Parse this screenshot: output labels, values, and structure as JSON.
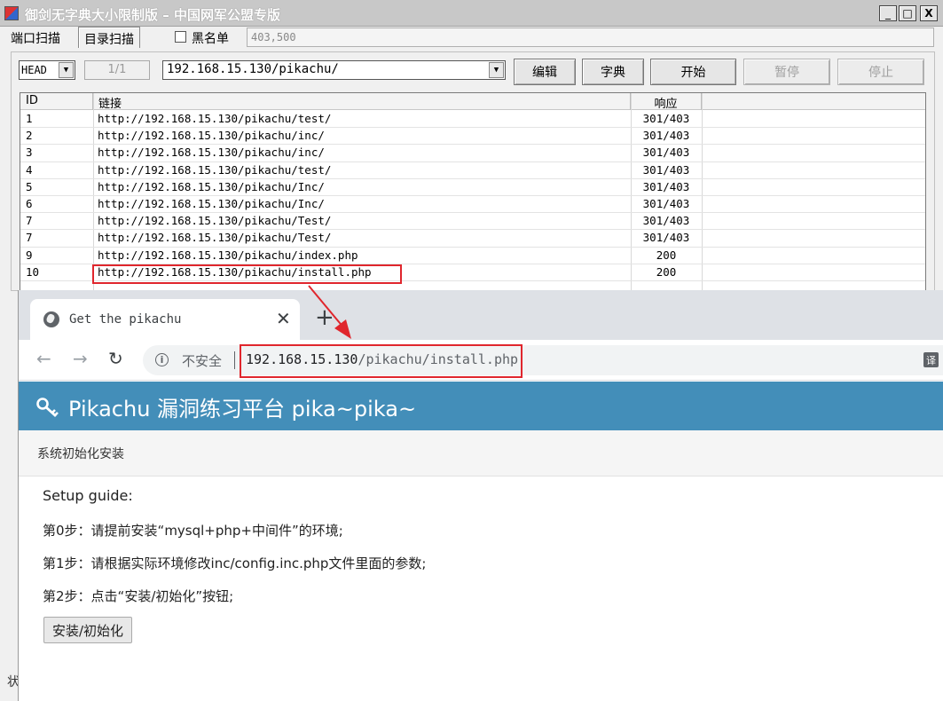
{
  "scanner": {
    "title": "御剑无字典大小限制版 – 中国网军公盟专版",
    "window_controls": {
      "minimize": "_",
      "maximize": "□",
      "close": "X"
    },
    "tabs": [
      {
        "label": "端口扫描"
      },
      {
        "label": "目录扫描"
      }
    ],
    "blacklist_label": "黑名单",
    "blacklist_checked": false,
    "status_codes_value": "403,500",
    "method": "HEAD",
    "page_counter": "1/1",
    "target_url": "192.168.15.130/pikachu/",
    "buttons": {
      "edit": "编辑",
      "dictionary": "字典",
      "start": "开始",
      "pause": "暂停",
      "stop": "停止"
    },
    "columns": {
      "id": "ID",
      "link": "链接",
      "response": "响应"
    },
    "rows": [
      {
        "id": "1",
        "link": "http://192.168.15.130/pikachu/test/",
        "response": "301/403"
      },
      {
        "id": "2",
        "link": "http://192.168.15.130/pikachu/inc/",
        "response": "301/403"
      },
      {
        "id": "3",
        "link": "http://192.168.15.130/pikachu/inc/",
        "response": "301/403"
      },
      {
        "id": "4",
        "link": "http://192.168.15.130/pikachu/test/",
        "response": "301/403"
      },
      {
        "id": "5",
        "link": "http://192.168.15.130/pikachu/Inc/",
        "response": "301/403"
      },
      {
        "id": "6",
        "link": "http://192.168.15.130/pikachu/Inc/",
        "response": "301/403"
      },
      {
        "id": "7",
        "link": "http://192.168.15.130/pikachu/Test/",
        "response": "301/403"
      },
      {
        "id": "7",
        "link": "http://192.168.15.130/pikachu/Test/",
        "response": "301/403"
      },
      {
        "id": "9",
        "link": "http://192.168.15.130/pikachu/index.php",
        "response": "200"
      },
      {
        "id": "10",
        "link": "http://192.168.15.130/pikachu/install.php",
        "response": "200"
      }
    ],
    "status_char": "状"
  },
  "browser": {
    "tab_title": "Get the pikachu",
    "tab_close": "✕",
    "new_tab": "+",
    "nav": {
      "back": "←",
      "forward": "→",
      "reload": "↻"
    },
    "security_text": "不安全",
    "url_host": "192.168.15.130",
    "url_path": "/pikachu/install.php",
    "translate_icon": "译"
  },
  "page": {
    "header_title": "Pikachu 漏洞练习平台 pika~pika~",
    "header_color": "#438eb9",
    "breadcrumb": "系统初始化安装",
    "lines": [
      "Setup guide:",
      "第0步：请提前安装“mysql+php+中间件”的环境;",
      "第1步：请根据实际环境修改inc/config.inc.php文件里面的参数;",
      "第2步：点击“安装/初始化”按钮;"
    ],
    "install_button": "安装/初始化"
  },
  "annotations": {
    "highlight_color": "#e0262d"
  }
}
